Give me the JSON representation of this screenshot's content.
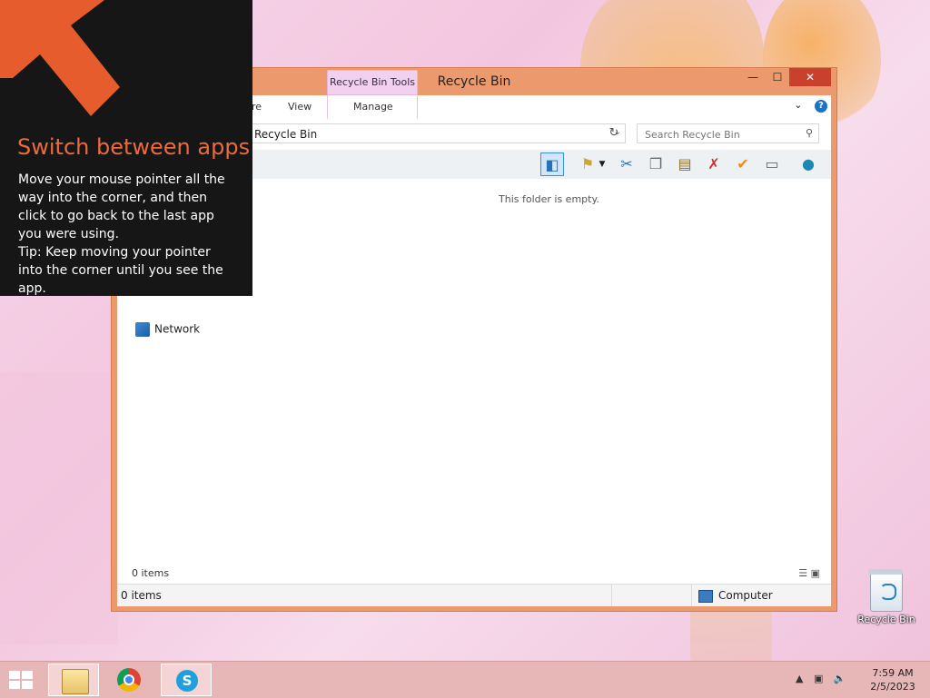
{
  "window": {
    "title": "Recycle Bin",
    "context_tab_group": "Recycle Bin Tools",
    "controls": {
      "minimize": "—",
      "maximize": "☐",
      "close": "✕"
    }
  },
  "ribbon": {
    "tabs": [
      {
        "label": "re"
      },
      {
        "label": "View"
      },
      {
        "label": "Manage"
      }
    ],
    "collapse": "⌄",
    "help": "?"
  },
  "address_bar": {
    "path": "Recycle Bin",
    "dropdown": "⌄",
    "refresh": "↻"
  },
  "search": {
    "placeholder": "Search Recycle Bin",
    "icon": "search-icon"
  },
  "toolbar": {
    "icons": [
      "preview-pane-icon",
      "properties-icon",
      "dropdown-icon",
      "cut-icon",
      "copy-icon",
      "paste-icon",
      "delete-icon",
      "checkmark-icon",
      "rename-icon",
      "globe-icon"
    ]
  },
  "content": {
    "empty_message": "This folder is empty.",
    "nav_network": "Network",
    "items_count": "0 items"
  },
  "status_bar": {
    "left": "0 items",
    "right": "Computer"
  },
  "hint": {
    "title": "Switch between apps",
    "body1": "Move your mouse pointer all the way into the corner, and then click to go back to the last app you were using.",
    "body2": "Tip: Keep moving your pointer into the corner until you see the app.",
    "accent_color": "#ec6a3f"
  },
  "desktop": {
    "icons": [
      {
        "label": "Recycle Bin"
      }
    ]
  },
  "taskbar": {
    "apps": [
      "File Explorer",
      "Google Chrome",
      "Skype"
    ],
    "tray": {
      "up_arrow": "▲",
      "network": "▣",
      "volume": "🔈"
    },
    "clock": {
      "time": "7:59 AM",
      "date": "2/5/2023"
    }
  }
}
